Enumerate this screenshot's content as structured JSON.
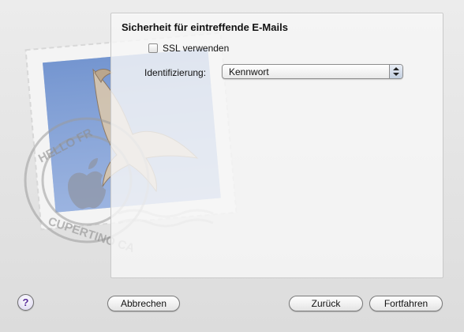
{
  "section": {
    "title": "Sicherheit für eintreffende E-Mails"
  },
  "ssl": {
    "label": "SSL verwenden",
    "checked": false
  },
  "identification": {
    "label": "Identifizierung:",
    "value": "Kennwort"
  },
  "buttons": {
    "help": "?",
    "cancel": "Abbrechen",
    "back": "Zurück",
    "continue": "Fortfahren"
  },
  "stamp": {
    "postmark_top": "HELLO FR",
    "postmark_bottom": "CUPERTINO CA"
  },
  "colors": {
    "stamp_blue": "#7f9fd6",
    "help_purple": "#5a2d9a"
  },
  "icons": {
    "stamp": "mail-stamp-eagle-icon",
    "apple": "apple-logo-icon",
    "popup": "up-down-arrows-icon",
    "help": "question-mark-icon"
  }
}
